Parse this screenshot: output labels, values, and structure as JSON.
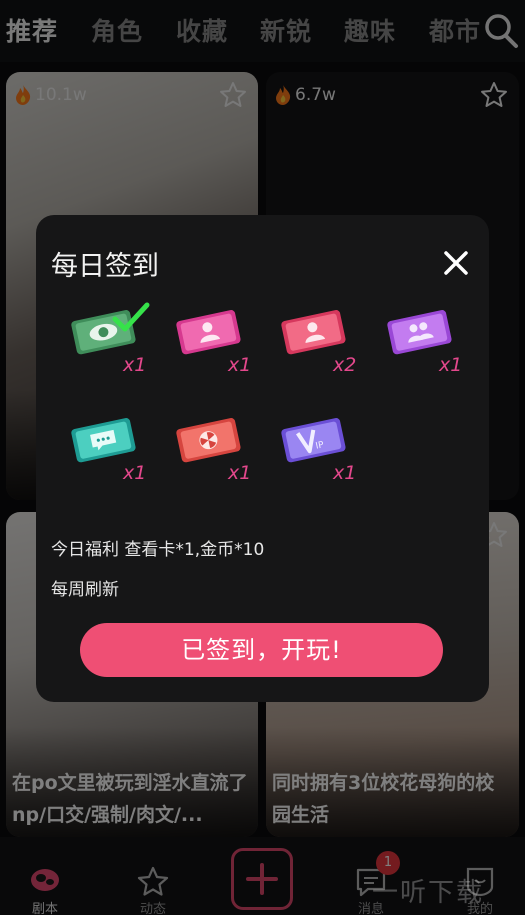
{
  "tabs": [
    {
      "label": "推荐",
      "active": true
    },
    {
      "label": "角色",
      "active": false
    },
    {
      "label": "收藏",
      "active": false
    },
    {
      "label": "新锐",
      "active": false
    },
    {
      "label": "趣味",
      "active": false
    },
    {
      "label": "都市",
      "active": false
    }
  ],
  "search": {
    "icon": "search-icon"
  },
  "feed": [
    {
      "views": "10.1w",
      "title": ""
    },
    {
      "views": "6.7w",
      "title": ""
    },
    {
      "views": "",
      "title": "在po文里被玩到淫水直流了 np/口交/强制/肉文/..."
    },
    {
      "views": "",
      "title": "同时拥有3位校花母狗的校园生活"
    }
  ],
  "dialog": {
    "title": "每日签到",
    "rewards": [
      {
        "count": "x1",
        "icon": "eye-ticket-icon",
        "checked": true
      },
      {
        "count": "x1",
        "icon": "user-ticket-icon",
        "checked": false
      },
      {
        "count": "x2",
        "icon": "user-ticket-icon",
        "checked": false
      },
      {
        "count": "x1",
        "icon": "group-ticket-icon",
        "checked": false
      },
      {
        "count": "x1",
        "icon": "chat-ticket-icon",
        "checked": false
      },
      {
        "count": "x1",
        "icon": "fan-ticket-icon",
        "checked": false
      },
      {
        "count": "x1",
        "icon": "vip-ticket-icon",
        "checked": false
      }
    ],
    "benefit": "今日福利 查看卡*1,金币*10",
    "weekly_note": "每周刷新",
    "button": "已签到，开玩!"
  },
  "nav": [
    {
      "label": "剧本",
      "active": true
    },
    {
      "label": "动态",
      "active": false
    },
    {
      "label": "消息",
      "active": false,
      "badge": "1"
    },
    {
      "label": "我的",
      "active": false
    }
  ],
  "watermark": "一听下载",
  "colors": {
    "accent": "#ef4f74",
    "background": "#0b0b0d",
    "dialog": "#161617"
  }
}
